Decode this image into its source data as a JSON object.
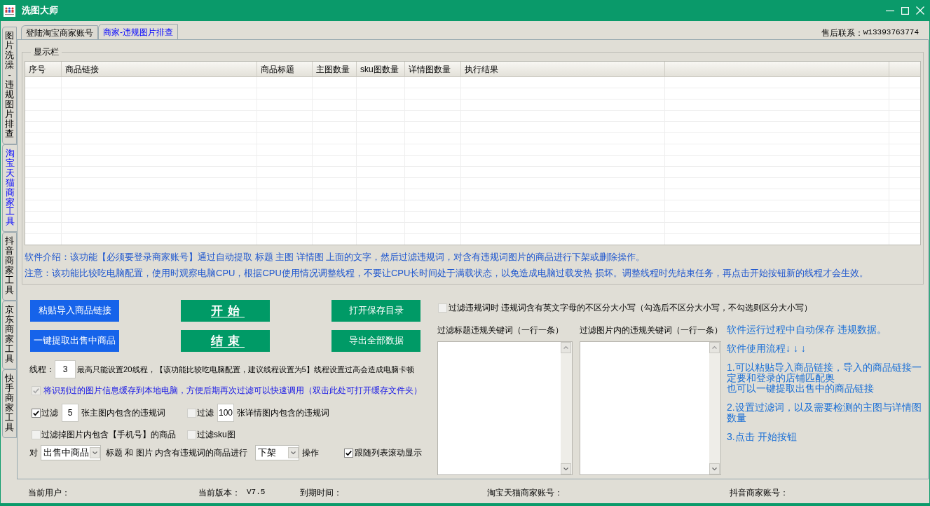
{
  "window": {
    "title": "洗图大师"
  },
  "side_tabs": [
    {
      "label": "图片洗澡-违规图片排查",
      "selected": false
    },
    {
      "label": "淘宝天猫商家工具",
      "selected": true
    },
    {
      "label": "抖音商家工具",
      "selected": false
    },
    {
      "label": "京东商家工具",
      "selected": false
    },
    {
      "label": "快手商家工具",
      "selected": false
    }
  ],
  "top_tabs": [
    {
      "label": "登陆淘宝商家账号",
      "selected": false
    },
    {
      "label": "商家-违规图片排查",
      "selected": true
    }
  ],
  "contact": {
    "label": "售后联系：",
    "value": "w13393763774"
  },
  "display_group": {
    "title": "显示栏",
    "table": {
      "columns": [
        "序号",
        "商品链接",
        "商品标题",
        "主图数量",
        "sku图数量",
        "详情图数量",
        "执行结果"
      ]
    }
  },
  "notes": [
    "软件介绍：该功能【必须要登录商家账号】通过自动提取 标题 主图 详情图 上面的文字，然后过滤违规词，对含有违规词图片的商品进行下架或删除操作。",
    "注意：该功能比较吃电脑配置，使用时观察电脑CPU，根据CPU使用情况调整线程，不要让CPU长时间处于满载状态，以免造成电脑过载发热 损坏。调整线程时先结束任务，再点击开始按钮新的线程才会生效。"
  ],
  "buttons": [
    {
      "label": "粘贴导入商品链接",
      "kind": "source"
    },
    {
      "label": "开始",
      "kind": "control"
    },
    {
      "label": "打开保存目录",
      "kind": "output"
    },
    {
      "label": "一键提取出售中商品",
      "kind": "source"
    },
    {
      "label": "结束",
      "kind": "control"
    },
    {
      "label": "导出全部数据",
      "kind": "output"
    }
  ],
  "threads": {
    "label": "线程：",
    "value": "3",
    "hint": "最高只能设置20线程，【该功能比较吃电脑配置，建议线程设置为5】线程设置过高会造成电脑卡顿"
  },
  "cache_option": {
    "label": "将识别过的图片信息缓存到本地电脑，方便后期再次过滤可以快速调用（双击此处可打开缓存文件夹）",
    "checked": true,
    "disabled": true
  },
  "filters": [
    {
      "kind": "count",
      "checked": true,
      "label": "过滤",
      "value": "5",
      "suffix": "张主图内包含的违规词"
    },
    {
      "kind": "count",
      "checked": false,
      "label": "过滤",
      "value": "100",
      "suffix": "张详情图内包含的违规词"
    },
    {
      "kind": "plain",
      "checked": false,
      "label": "过滤掉图片内包含【手机号】的商品"
    },
    {
      "kind": "plain",
      "checked": false,
      "label": "过滤sku图"
    }
  ],
  "action_row": {
    "prefix": "对",
    "scope": "出售中商品",
    "middle": "标题 和 图片 内含有违规词的商品进行",
    "operation": "下架",
    "suffix": "操作"
  },
  "follow_scroll": {
    "label": "跟随列表滚动显示",
    "checked": true
  },
  "case_option": {
    "label": "过滤违规词时 违规词含有英文字母的不区分大小写（勾选后不区分大小写，不勾选则区分大小写）",
    "checked": false
  },
  "keyword_boxes": [
    {
      "label": "过滤标题违规关键词（一行一条）"
    },
    {
      "label": "过滤图片内的违规关键词（一行一条）"
    }
  ],
  "help": {
    "autosave": "软件运行过程中自动保存 违规数据。",
    "flow_title": "软件使用流程↓ ↓ ↓",
    "steps": [
      {
        "lines": [
          "1.可以粘贴导入商品链接，导入的商品链接一定要和登录的店铺匹配奥",
          "也可以一键提取出售中的商品链接"
        ]
      },
      {
        "lines": [
          "2.设置过滤词，以及需要检测的主图与详情图数量"
        ]
      },
      {
        "lines": [
          "3.点击 开始按钮"
        ]
      }
    ]
  },
  "status_bar": [
    {
      "label": "当前用户："
    },
    {
      "label": "当前版本：",
      "value": "V7.5"
    },
    {
      "label": "到期时间："
    },
    {
      "label": "淘宝天猫商家账号："
    },
    {
      "label": "抖音商家账号："
    }
  ]
}
